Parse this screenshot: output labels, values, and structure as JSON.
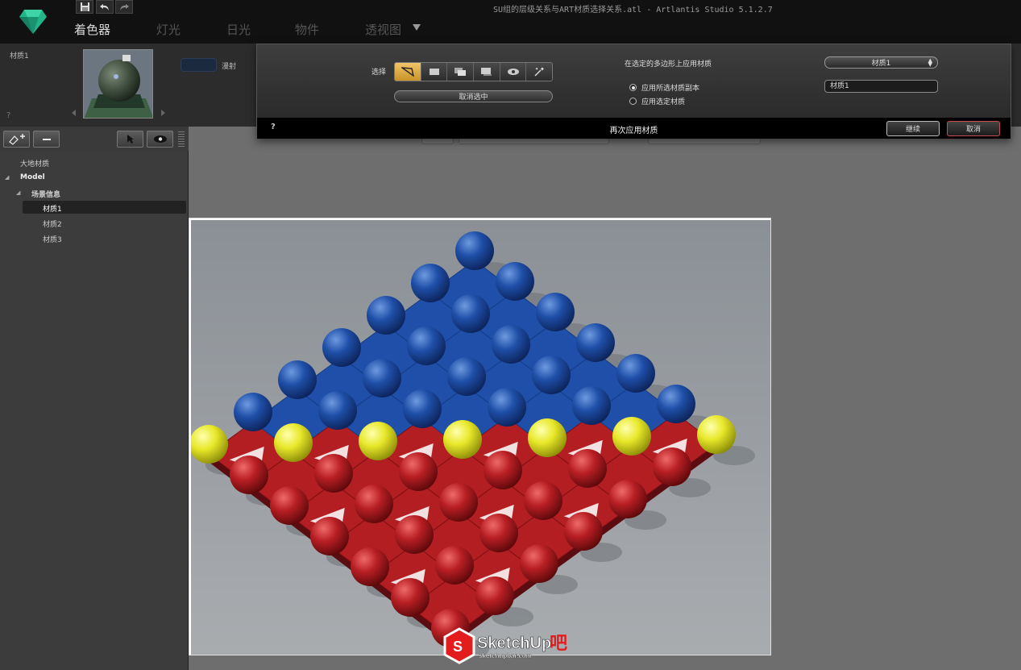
{
  "window": {
    "title": "SU组的层级关系与ART材质选择关系.atl - Artlantis Studio 5.1.2.7"
  },
  "tabs": [
    {
      "label": "着色器",
      "active": true
    },
    {
      "label": "灯光",
      "active": false
    },
    {
      "label": "日光",
      "active": false
    },
    {
      "label": "物件",
      "active": false
    },
    {
      "label": "透视图",
      "active": false
    }
  ],
  "quick_icons": [
    "save-icon",
    "undo-icon",
    "redo-icon"
  ],
  "material_strip": {
    "name": "材质1",
    "reflection_label": "漫射",
    "help": "?"
  },
  "dialog": {
    "selection_label": "选择",
    "selection_tools": [
      "polygon-select-icon",
      "rectangle-select-icon",
      "layer-select-icon",
      "object-select-icon",
      "eye-select-icon",
      "magic-select-icon"
    ],
    "cancel_selection_label": "取消选中",
    "apply_title": "在选定的多边形上应用材质",
    "radio_options": [
      {
        "label": "应用所选材质副本",
        "checked": true
      },
      {
        "label": "应用选定材质",
        "checked": false
      }
    ],
    "material_dropdown_value": "材质1",
    "material_name_value": "材质1",
    "footer_help": "?",
    "footer_title": "再次应用材质",
    "continue_label": "继续",
    "cancel_label": "取消"
  },
  "tree": {
    "items": [
      {
        "label": "大地材质"
      },
      {
        "label": "Model"
      },
      {
        "label": "场景信息"
      },
      {
        "label": "材质1"
      },
      {
        "label": "材质2"
      },
      {
        "label": "材质3"
      }
    ],
    "selected": "材质1"
  },
  "viewport": {
    "scene": "3D render of sphere grid with blue, yellow and red materials"
  },
  "watermark": {
    "brand": "SketchUp吧",
    "url": "sketchupbar.com"
  },
  "colors": {
    "accent": "#e8b44a",
    "blue": "#1f4fa8",
    "red": "#b81f24",
    "yellow": "#e8e82a",
    "cancel_border": "#c64b4b"
  }
}
